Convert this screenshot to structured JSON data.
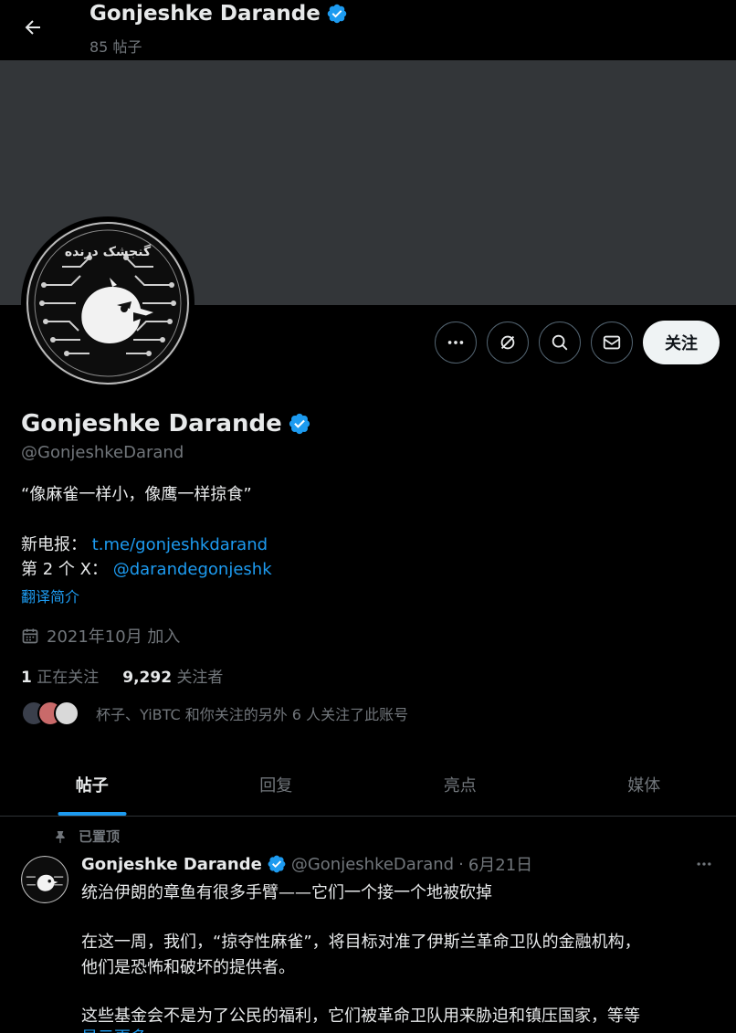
{
  "header": {
    "name": "Gonjeshke Darande",
    "post_count": "85 帖子"
  },
  "profile": {
    "name": "Gonjeshke Darande",
    "handle": "@GonjeshkeDarand",
    "bio": "“像麻雀一样小，像鹰一样掠食”",
    "telegram_label": "新电报：",
    "telegram_link": "t.me/gonjeshkdarand",
    "second_x_label": "第 2 个 X：",
    "second_x_link": "@darandegonjeshk",
    "translate_bio": "翻译简介",
    "joined": "2021年10月 加入",
    "following_count": "1",
    "following_label": "正在关注",
    "followers_count": "9,292",
    "followers_label": "关注者",
    "followed_by": "杯子、YiBTC 和你关注的另外 6 人关注了此账号",
    "avatar_text": "گنجشک درنده"
  },
  "actions": {
    "follow_label": "关注"
  },
  "tabs": [
    {
      "label": "帖子",
      "active": true
    },
    {
      "label": "回复",
      "active": false
    },
    {
      "label": "亮点",
      "active": false
    },
    {
      "label": "媒体",
      "active": false
    }
  ],
  "post": {
    "pinned_label": "已置顶",
    "name": "Gonjeshke Darande",
    "handle": "@GonjeshkeDarand",
    "separator": "·",
    "date": "6月21日",
    "line1": "统治伊朗的章鱼有很多手臂——它们一个接一个地被砍掉",
    "line2": "在这一周，我们，“掠夺性麻雀”，将目标对准了伊斯兰革命卫队的金融机构，",
    "line3": "他们是恐怖和破坏的提供者。",
    "line4": "这些基金会不是为了公民的福利，它们被革命卫队用来胁迫和镇压国家，等等",
    "show_more": "显示更多"
  },
  "colors": {
    "accent": "#1d9bf0",
    "verified": "#1d9bf0",
    "muted": "#71767b",
    "banner": "#333639"
  }
}
